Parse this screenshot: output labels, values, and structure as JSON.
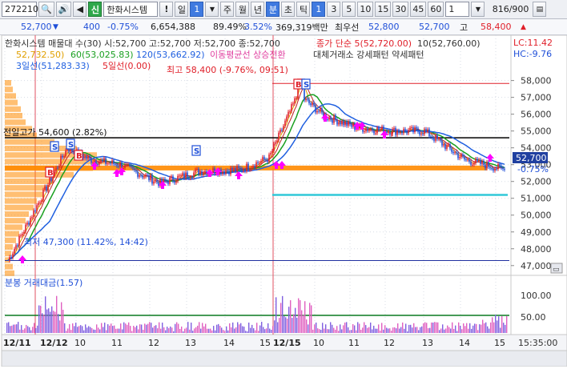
{
  "toolbar": {
    "code": "272210",
    "name": "한화시스템",
    "shin": "신",
    "excl": "!",
    "period_il": "일",
    "period_il_num": "1",
    "periods": [
      "주",
      "월",
      "년",
      "분",
      "초",
      "틱"
    ],
    "nums": [
      "1",
      "3",
      "5",
      "10",
      "15",
      "30",
      "45",
      "60"
    ],
    "count": "1",
    "page": "816/900"
  },
  "priceline": {
    "price": "52,700",
    "change": "400",
    "rate": "-0.75%",
    "volume": "6,654,388",
    "vol_ratio": "89.49%",
    "turnover": "3.52%",
    "amount": "369,319백만",
    "best_label": "최우선",
    "best_ask": "52,800",
    "best_bid": "52,700",
    "high_label": "고",
    "high": "58,400"
  },
  "legend": {
    "line1": "한화시스템 매물대 수(30)  시:52,700 고:52,700 저:52,700 종:52,700",
    "line1b": "종가 단순 5(52,720.00)",
    "line1c": "10(52,760.00)",
    "line2a": "52,732.50)",
    "line2b": "60(53,025.83)",
    "line2c": "120(53,662.92)",
    "line2d": "이동평균선 상승전환",
    "line2e": "대체거래소 강세패턴    약세패턴",
    "line3a": "3일선(51,283.33)",
    "line3b": "5일선(0.00)",
    "lc": "LC:11.42",
    "hc": "HC:-9.76"
  },
  "annotations": {
    "high": "최고 58,400 (-9.76%, 09:51)",
    "prev_high": "전일고가 54,600 (2.82%)",
    "low": "최저 47,300 (11.42%, 14:42)",
    "last_price": "52,700",
    "last_rate": "-0.75%",
    "signals": [
      "S",
      "S",
      "B",
      "S",
      "B"
    ]
  },
  "price_axis": [
    "58,000",
    "57,000",
    "56,000",
    "55,000",
    "54,000",
    "53,000",
    "52,000",
    "51,000",
    "50,000",
    "49,000",
    "48,000",
    "47,000"
  ],
  "volume_pane": {
    "title": "분봉 거래대금(1.57)",
    "axis": [
      "100.00",
      "50.00"
    ]
  },
  "time_axis": [
    "12/11",
    "12/12",
    "10",
    "11",
    "12",
    "13",
    "14",
    "15",
    "12/15",
    "10",
    "11",
    "12",
    "13",
    "14",
    "15"
  ],
  "clock": "15:35:00",
  "colors": {
    "up": "#e0202a",
    "down": "#1f4fd8",
    "ma5": "#e0a000",
    "ma10": "#c02020",
    "ma20": "#1aa020",
    "ma60": "#2060e0",
    "volume_profile": "#ff8a00",
    "signal": "#ff00ff",
    "support": "#30c8d8"
  },
  "chart_data": {
    "type": "line",
    "title": "한화시스템",
    "x": [
      "12/11",
      "12/12 09",
      "10",
      "11",
      "12",
      "13",
      "14",
      "15",
      "12/15 09",
      "10",
      "11",
      "12",
      "13",
      "14",
      "15"
    ],
    "series": [
      {
        "name": "종가",
        "values": [
          47300,
          54000,
          53300,
          53000,
          51900,
          52600,
          52700,
          53400,
          57200,
          55900,
          55200,
          55000,
          55000,
          53300,
          52700
        ]
      }
    ],
    "ylim": [
      46800,
      58600
    ],
    "annotations": [
      "최고 58,400 (-9.76%, 09:51)",
      "전일고가 54,600 (2.82%)",
      "최저 47,300 (11.42%, 14:42)"
    ]
  }
}
